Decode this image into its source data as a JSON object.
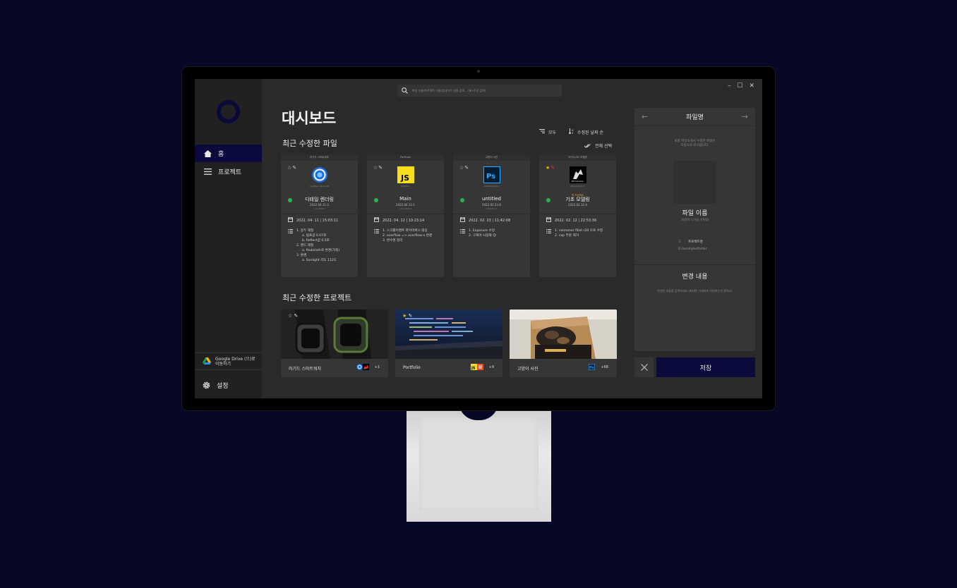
{
  "search": {
    "placeholder": "파일 이름/프로젝트 이름/업데이트 내용 검색... (⌘+F로 검색)"
  },
  "window": {
    "controls": "– ☐ ✕"
  },
  "sidebar": {
    "items": [
      {
        "label": "홈",
        "icon": "home-icon"
      },
      {
        "label": "프로젝트",
        "icon": "menu-icon"
      }
    ],
    "gdrive_label": "Google Drive (으)로 이동하기",
    "settings_label": "설정"
  },
  "page": {
    "title": "대시보드"
  },
  "filters": {
    "all_label": "모두",
    "sort_label": "수정된 날짜 순",
    "select_all_label": "전체 선택"
  },
  "sections": {
    "recent_files": "최근 수정한 파일",
    "recent_projects": "최근 수정한 프로젝트"
  },
  "files": [
    {
      "category": "러기드 스마트워치",
      "app": "keyshot",
      "app_sub": "KeyShot 10.0.198",
      "tag": "",
      "name": "디테일 렌더링",
      "version": "2022.04.11-3",
      "sub": "v.4e2f0f5d",
      "star": false,
      "pin": false,
      "date": "2022. 04. 11 | 15:03:11",
      "notes": [
        {
          "text": "1. 용두 재질",
          "sub": false
        },
        {
          "text": "a. 범프값 0.07로",
          "sub": true
        },
        {
          "text": "b. Reflect값 0.5로",
          "sub": true
        },
        {
          "text": "2. 밴드 재질",
          "sub": false
        },
        {
          "text": "a. Realcloth로 변경(가죽)",
          "sub": true
        },
        {
          "text": "3. 환경",
          "sub": false
        },
        {
          "text": "a. Sunlight 각도 112도",
          "sub": true
        }
      ]
    },
    {
      "category": "Portfolio",
      "app": "js",
      "app_sub": "Portfolio",
      "tag": "",
      "name": "Main",
      "version": "2022.04.12-1",
      "sub": "v.8cd4b9e2",
      "star": false,
      "pin": false,
      "date": "2022. 04. 12 | 10:23:14",
      "notes": [
        {
          "text": "1. 스크롤이벤트 파이어폭스 대응",
          "sub": false
        },
        {
          "text": "2. overflow => overflow-x 변경",
          "sub": false
        },
        {
          "text": "3. 변수명 정리",
          "sub": false
        }
      ]
    },
    {
      "category": "고양이 사진",
      "app": "ps",
      "app_sub": "Photoshop CC",
      "tag": "",
      "name": "untitled",
      "version": "2022.02.23-6",
      "sub": "v.f9a07c31",
      "star": false,
      "pin": false,
      "date": "2022. 02. 23 | 11:42:08",
      "notes": [
        {
          "text": "1. Exposure 수정",
          "sub": false
        },
        {
          "text": "2. 구찌야 사랑해 😊",
          "sub": false
        }
      ]
    },
    {
      "category": "라이노/3D 모델링",
      "app": "rhino",
      "app_sub": "Rhinoceros 7",
      "tag": "원 프로젝트",
      "name": "기초 모델링",
      "version": "2022.02.12-4",
      "sub": "",
      "star": true,
      "pin": true,
      "date": "2022. 02. 12 | 22:53:36",
      "notes": [
        {
          "text": "1. container fillet r20 으로 수정",
          "sub": false
        },
        {
          "text": "2. cap 부분 제거",
          "sub": false
        }
      ]
    }
  ],
  "projects": [
    {
      "name": "러기드 스마트워치",
      "count": "+1",
      "star": false,
      "thumb": "watch"
    },
    {
      "name": "Portfolio",
      "count": "+9",
      "star": true,
      "thumb": "code"
    },
    {
      "name": "고양이 사진",
      "count": "+68",
      "star": false,
      "thumb": "cat"
    }
  ],
  "panel": {
    "header": "파일명",
    "empty_msg_1": "로컬 저장소에서 수정된 파일이",
    "empty_msg_2": "자동으로 표시됩니다.",
    "filename_label": "파일 이름",
    "filename_sub": "(저장력 시 자동 선택됨)",
    "project_label": "프로젝트명",
    "path": "D:/example/folder",
    "changes_label": "변경 내용",
    "changes_sub": "변경한 내용을 입력하세요 (최대한 자세하게 작성하는게 좋아요)",
    "save_label": "저장"
  },
  "colors": {
    "accent": "#0a0a3c",
    "status_ok": "#2db24b",
    "star": "#f2b705"
  }
}
